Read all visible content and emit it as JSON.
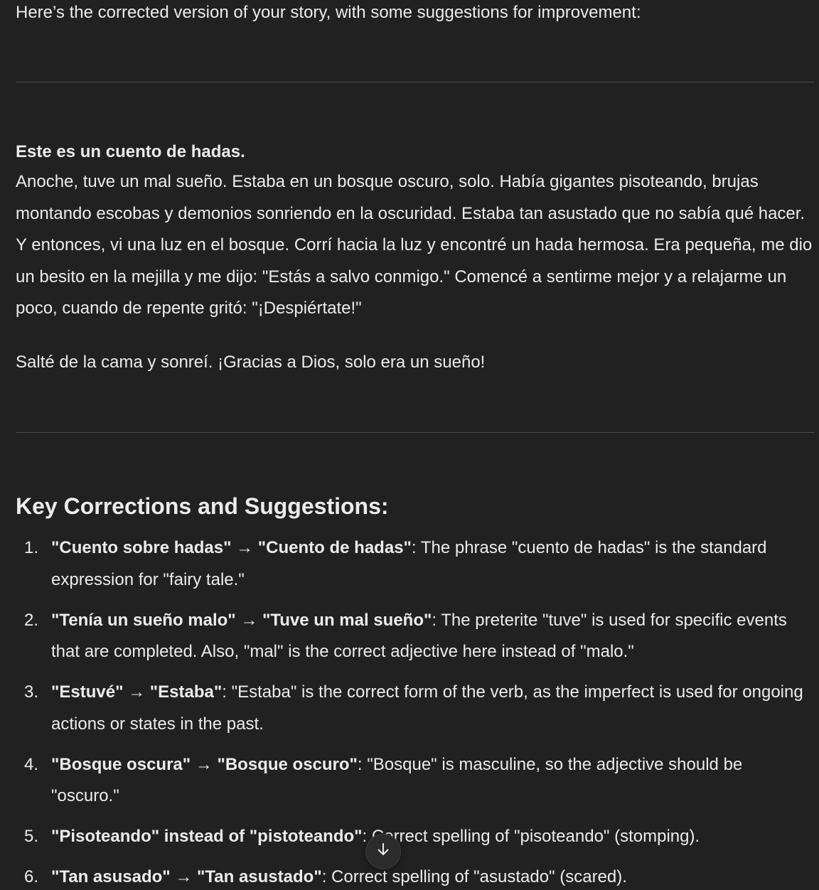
{
  "intro": "Here’s the corrected version of your story, with some suggestions for improvement:",
  "story": {
    "title": "Este es un cuento de hadas.",
    "body": "Anoche, tuve un mal sueño. Estaba en un bosque oscuro, solo. Había gigantes pisoteando, brujas montando escobas y demonios sonriendo en la oscuridad. Estaba tan asustado que no sabía qué hacer. Y entonces, vi una luz en el bosque. Corrí hacia la luz y encontré un hada hermosa. Era pequeña, me dio un besito en la mejilla y me dijo: \"Estás a salvo conmigo.\" Comencé a sentirme mejor y a relajarme un poco, cuando de repente gritó: \"¡Despiértate!\"",
    "ending": "Salté de la cama y sonreí. ¡Gracias a Dios, solo era un sueño!"
  },
  "corrections": {
    "heading": "Key Corrections and Suggestions:",
    "items": [
      {
        "num": "1.",
        "bold": "\"Cuento sobre hadas\" → \"Cuento de hadas\"",
        "text": ": The phrase \"cuento de hadas\" is the standard expression for \"fairy tale.\""
      },
      {
        "num": "2.",
        "bold": "\"Tenía un sueño malo\" → \"Tuve un mal sueño\"",
        "text": ": The preterite \"tuve\" is used for specific events that are completed. Also, \"mal\" is the correct adjective here instead of \"malo.\""
      },
      {
        "num": "3.",
        "bold": "\"Estuvé\" → \"Estaba\"",
        "text": ": \"Estaba\" is the correct form of the verb, as the imperfect is used for ongoing actions or states in the past."
      },
      {
        "num": "4.",
        "bold": "\"Bosque oscura\" → \"Bosque oscuro\"",
        "text": ": \"Bosque\" is masculine, so the adjective should be \"oscuro.\""
      },
      {
        "num": "5.",
        "bold": "\"Pisoteando\" instead of \"pistoteando\"",
        "text": ": Correct spelling of \"pisoteando\" (stomping)."
      },
      {
        "num": "6.",
        "bold": "\"Tan asusado\" → \"Tan asustado\"",
        "text": ": Correct spelling of \"asustado\" (scared)."
      }
    ]
  },
  "scroll_button": {
    "icon": "arrow-down-icon"
  },
  "colors": {
    "background": "#212121",
    "text": "#ececec",
    "divider": "#4a4a4a"
  }
}
